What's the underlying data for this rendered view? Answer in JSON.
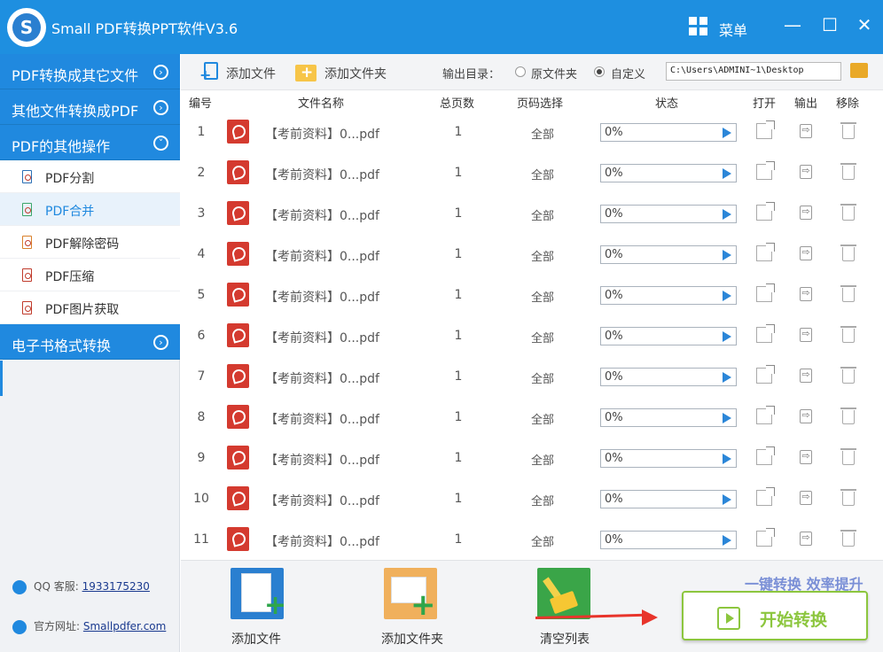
{
  "window": {
    "title": "Small PDF转换PPT软件V3.6",
    "logo_letter": "S",
    "menu_label": "菜单",
    "minimize": "—",
    "maximize": "☐",
    "close": "✕"
  },
  "sidebar": {
    "categories": [
      {
        "label": "PDF转换成其它文件",
        "icon": "›"
      },
      {
        "label": "其他文件转换成PDF",
        "icon": "›"
      },
      {
        "label": "PDF的其他操作",
        "icon": "˅"
      },
      {
        "label": "电子书格式转换",
        "icon": "›"
      }
    ],
    "items": [
      {
        "label": "PDF分割"
      },
      {
        "label": "PDF合并"
      },
      {
        "label": "PDF解除密码"
      },
      {
        "label": "PDF压缩"
      },
      {
        "label": "PDF图片获取"
      }
    ],
    "qq_label": "QQ 客服:",
    "qq_value": "1933175230",
    "site_label": "官方网址:",
    "site_value": "Smallpdfer.com"
  },
  "toolbar": {
    "add_file": "添加文件",
    "add_folder": "添加文件夹",
    "output_dir_label": "输出目录：",
    "option_original": "原文件夹",
    "option_custom": "自定义",
    "path_value": "C:\\Users\\ADMINI~1\\Desktop"
  },
  "table": {
    "headers": {
      "num": "编号",
      "name": "文件名称",
      "pages": "总页数",
      "range": "页码选择",
      "status": "状态",
      "open": "打开",
      "output": "输出",
      "remove": "移除"
    },
    "rows": [
      {
        "num": "1",
        "name": "【考前资料】0...pdf",
        "pages": "1",
        "range": "全部",
        "progress": "0%"
      },
      {
        "num": "2",
        "name": "【考前资料】0...pdf",
        "pages": "1",
        "range": "全部",
        "progress": "0%"
      },
      {
        "num": "3",
        "name": "【考前资料】0...pdf",
        "pages": "1",
        "range": "全部",
        "progress": "0%"
      },
      {
        "num": "4",
        "name": "【考前资料】0...pdf",
        "pages": "1",
        "range": "全部",
        "progress": "0%"
      },
      {
        "num": "5",
        "name": "【考前资料】0...pdf",
        "pages": "1",
        "range": "全部",
        "progress": "0%"
      },
      {
        "num": "6",
        "name": "【考前资料】0...pdf",
        "pages": "1",
        "range": "全部",
        "progress": "0%"
      },
      {
        "num": "7",
        "name": "【考前资料】0...pdf",
        "pages": "1",
        "range": "全部",
        "progress": "0%"
      },
      {
        "num": "8",
        "name": "【考前资料】0...pdf",
        "pages": "1",
        "range": "全部",
        "progress": "0%"
      },
      {
        "num": "9",
        "name": "【考前资料】0...pdf",
        "pages": "1",
        "range": "全部",
        "progress": "0%"
      },
      {
        "num": "10",
        "name": "【考前资料】0...pdf",
        "pages": "1",
        "range": "全部",
        "progress": "0%"
      },
      {
        "num": "11",
        "name": "【考前资料】0...pdf",
        "pages": "1",
        "range": "全部",
        "progress": "0%"
      }
    ]
  },
  "bottom": {
    "add_file": "添加文件",
    "add_folder": "添加文件夹",
    "clear_list": "清空列表",
    "slogan": "一键转换  效率提升",
    "start": "开始转换"
  },
  "colors": {
    "title_bar": "#1e8fe0",
    "sidebar_category": "#2089df",
    "start_green": "#8cc63e",
    "pdf_red": "#d43a2f",
    "arrow_red": "#e8342b"
  }
}
